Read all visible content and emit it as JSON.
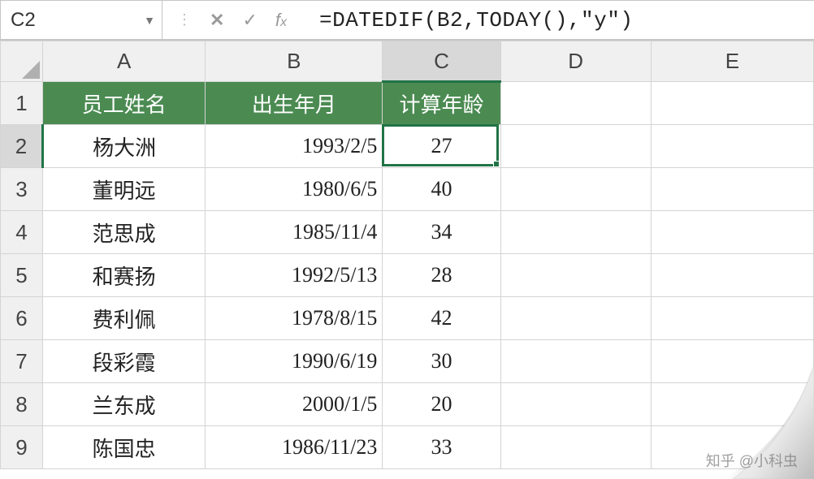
{
  "namebox": "C2",
  "formula": "=DATEDIF(B2,TODAY(),\"y\")",
  "columns": [
    "A",
    "B",
    "C",
    "D",
    "E"
  ],
  "active_col_index": 2,
  "active_row_index": 1,
  "header_row": {
    "A": "员工姓名",
    "B": "出生年月",
    "C": "计算年龄"
  },
  "rows": [
    {
      "n": 2,
      "name": "杨大洲",
      "date": "1993/2/5",
      "age": "27"
    },
    {
      "n": 3,
      "name": "董明远",
      "date": "1980/6/5",
      "age": "40"
    },
    {
      "n": 4,
      "name": "范思成",
      "date": "1985/11/4",
      "age": "34"
    },
    {
      "n": 5,
      "name": "和赛扬",
      "date": "1992/5/13",
      "age": "28"
    },
    {
      "n": 6,
      "name": "费利佩",
      "date": "1978/8/15",
      "age": "42"
    },
    {
      "n": 7,
      "name": "段彩霞",
      "date": "1990/6/19",
      "age": "30"
    },
    {
      "n": 8,
      "name": "兰东成",
      "date": "2000/1/5",
      "age": "20"
    },
    {
      "n": 9,
      "name": "陈国忠",
      "date": "1986/11/23",
      "age": "33"
    }
  ],
  "watermark": "知乎 @小科虫",
  "colors": {
    "header_bg": "#4b8b52",
    "excel_green": "#217346"
  }
}
